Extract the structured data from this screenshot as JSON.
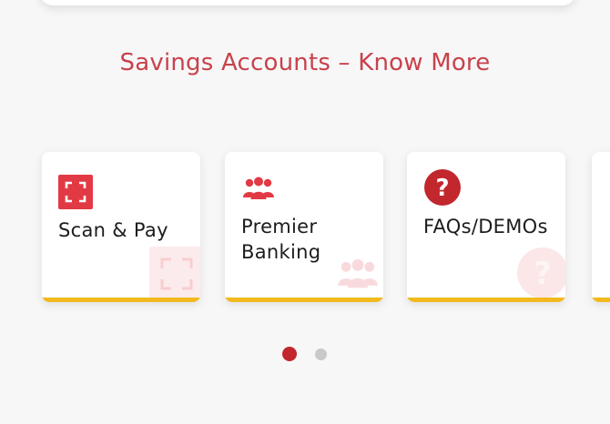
{
  "section": {
    "title": "Savings Accounts – Know More"
  },
  "tiles": [
    {
      "label": "Scan & Pay",
      "icon": "scan-qr-icon"
    },
    {
      "label": "Premier Banking",
      "icon": "group-users-icon"
    },
    {
      "label": "FAQs/DEMOs",
      "icon": "help-question-icon"
    }
  ],
  "pager": {
    "total_pages": 2,
    "active_page": 1
  },
  "colors": {
    "accent_red": "#e23a44",
    "title_red": "#c8424b",
    "tile_underline": "#f2b91f",
    "dot_active": "#c1272d",
    "dot_inactive": "#c9c9c9"
  }
}
